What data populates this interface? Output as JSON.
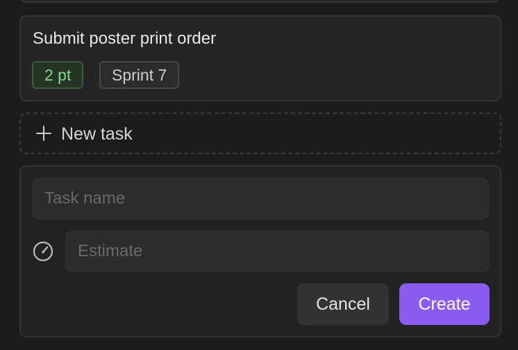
{
  "task_card": {
    "title": "Submit poster print order",
    "points_badge": "2 pt",
    "sprint_badge": "Sprint 7"
  },
  "new_task": {
    "label": "New task"
  },
  "form": {
    "task_name_placeholder": "Task name",
    "estimate_placeholder": "Estimate",
    "estimate_icon": "gauge-icon",
    "cancel_label": "Cancel",
    "create_label": "Create"
  },
  "colors": {
    "accent": "#8a5cf0",
    "points_badge_text": "#8fd28f",
    "background": "#1c1c1c"
  }
}
